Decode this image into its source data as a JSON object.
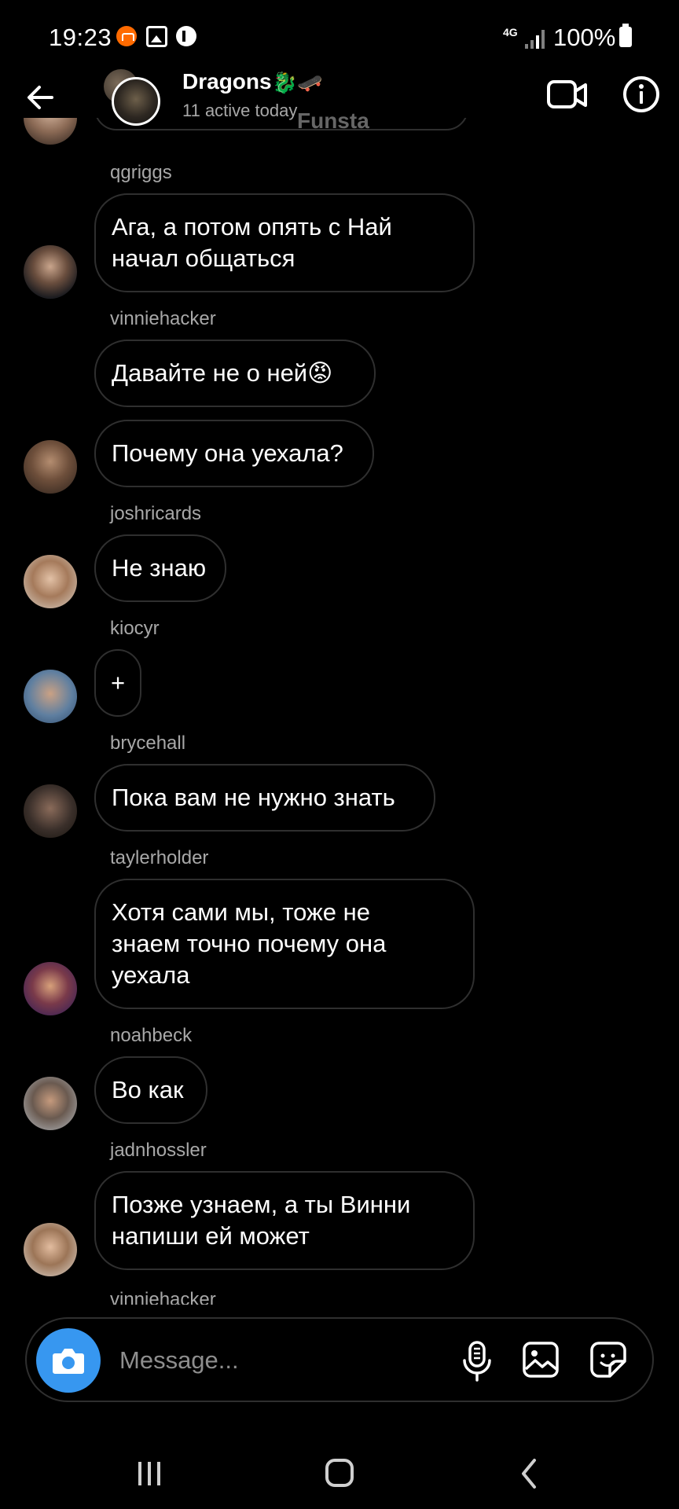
{
  "status_bar": {
    "time": "19:23",
    "network": "4G",
    "battery": "100%"
  },
  "header": {
    "group_name": "Dragons",
    "group_emoji": "🐉🛹",
    "status": "11 active today",
    "overlay_text": "Funsta"
  },
  "messages": [
    {
      "username": "qgriggs",
      "text": "Ага, а потом опять с Най\nначал общаться"
    },
    {
      "username": "vinniehacker",
      "text": "Давайте  не о ней😡"
    },
    {
      "username": "",
      "text": "Почему она уехала?"
    },
    {
      "username": "joshricards",
      "text": "Не знаю"
    },
    {
      "username": "kiocyr",
      "text": "+"
    },
    {
      "username": "brycehall",
      "text": "Пока вам не нужно знать"
    },
    {
      "username": "taylerholder",
      "text": "Хотя сами мы, тоже не\nзнаем точно почему она\nуехала"
    },
    {
      "username": "noahbeck",
      "text": "Во как"
    },
    {
      "username": "jadnhossler",
      "text": "Позже узнаем, а ты Винни\nнапиши ей может"
    }
  ],
  "next_username": "vinniehacker",
  "composer": {
    "placeholder": "Message..."
  },
  "colors": {
    "accent": "#3797f0",
    "background": "#000000",
    "bubble_border": "#2f2f2f",
    "secondary_text": "#a8a8a8"
  }
}
